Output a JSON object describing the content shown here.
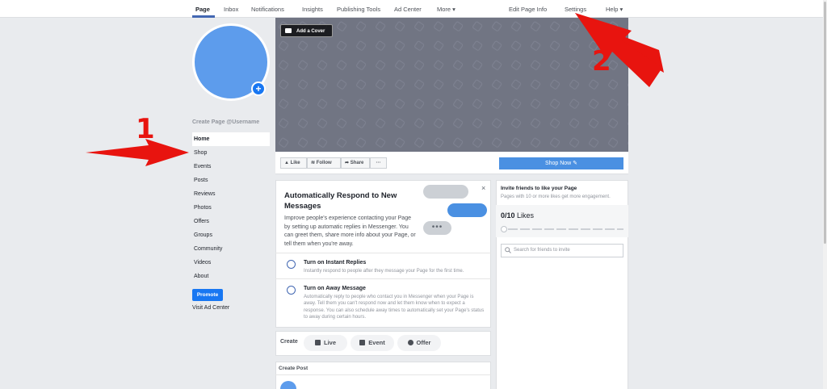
{
  "topnav": {
    "tabs": [
      {
        "label": "Page"
      },
      {
        "label": "Inbox"
      },
      {
        "label": "Notifications"
      },
      {
        "label": "Insights"
      },
      {
        "label": "Publishing Tools"
      },
      {
        "label": "Ad Center"
      },
      {
        "label": "More ▾"
      },
      {
        "label": "Edit Page Info"
      },
      {
        "label": "Settings"
      },
      {
        "label": "Help ▾"
      }
    ]
  },
  "sidebar": {
    "username": "Create Page @Username",
    "items": [
      {
        "label": "Home"
      },
      {
        "label": "Shop"
      },
      {
        "label": "Events"
      },
      {
        "label": "Posts"
      },
      {
        "label": "Reviews"
      },
      {
        "label": "Photos"
      },
      {
        "label": "Offers"
      },
      {
        "label": "Groups"
      },
      {
        "label": "Community"
      },
      {
        "label": "Videos"
      },
      {
        "label": "About"
      }
    ],
    "promote": "Promote",
    "visit_ad_center": "Visit Ad Center"
  },
  "cover": {
    "add_cover": "Add a Cover"
  },
  "actions": {
    "like": "Like",
    "follow": "Follow",
    "share": "Share",
    "more": "···",
    "shop_now": "Shop Now ✎"
  },
  "auto_respond": {
    "title": "Automatically Respond to New Messages",
    "description": "Improve people's experience contacting your Page by setting up automatic replies in Messenger. You can greet them, share more info about your Page, or tell them when you're away.",
    "close": "×",
    "typing": "•••",
    "rows": [
      {
        "title": "Turn on Instant Replies",
        "desc": "Instantly respond to people after they message your Page for the first time."
      },
      {
        "title": "Turn on Away Message",
        "desc": "Automatically reply to people who contact you in Messenger when your Page is away. Tell them you can't respond now and let them know when to expect a response. You can also schedule away times to automatically set your Page's status to away during certain hours."
      }
    ]
  },
  "create": {
    "label": "Create",
    "live": "Live",
    "event": "Event",
    "offer": "Offer"
  },
  "create_post": {
    "label": "Create Post"
  },
  "invite": {
    "title": "Invite friends to like your Page",
    "subtitle": "Pages with 10 or more likes get more engagement.",
    "count": "0/10",
    "likes_word": "Likes",
    "search_placeholder": "Search for friends to invite"
  },
  "annotations": {
    "one": "1",
    "two": "2"
  },
  "colors": {
    "accent": "#1877f2",
    "shop_now": "#4a90e2",
    "cover": "#717583",
    "annotation": "#e8140f"
  }
}
